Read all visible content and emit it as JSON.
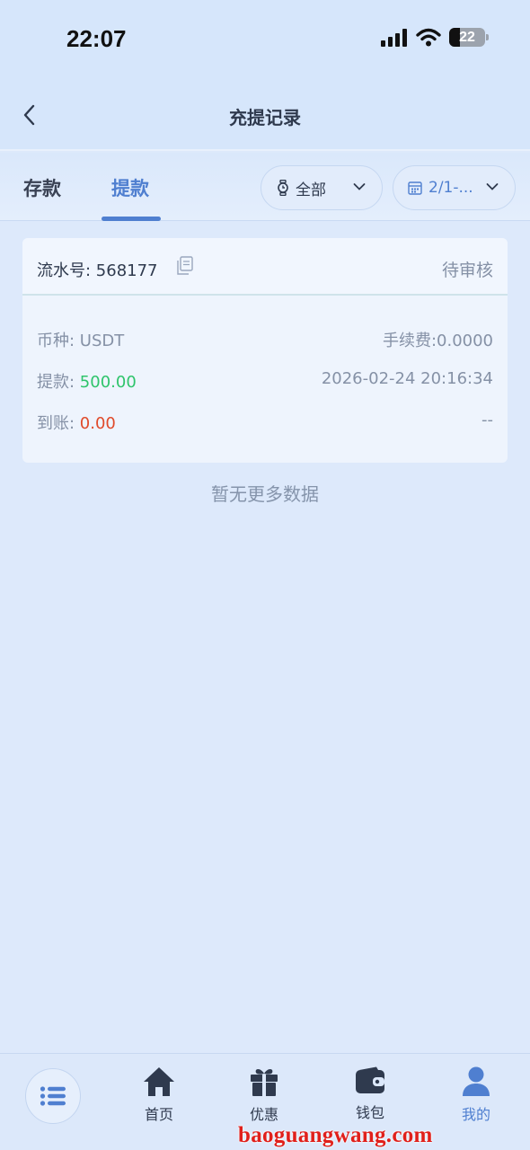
{
  "status_bar": {
    "time": "22:07",
    "battery": "22"
  },
  "header": {
    "title": "充提记录"
  },
  "tabs": [
    {
      "label": "存款"
    },
    {
      "label": "提款"
    }
  ],
  "filters": {
    "status_label": "全部",
    "date_label": "2/1-..."
  },
  "record": {
    "serial_label": "流水号: 568177",
    "status": "待审核",
    "currency_label": "币种: USDT",
    "fee": "手续费:0.0000",
    "withdraw_label": "提款: ",
    "withdraw_amount": "500.00",
    "time": "2026-02-24 20:16:34",
    "received_label": "到账: ",
    "received_amount": "0.00",
    "received_right": "--"
  },
  "list": {
    "no_more": "暂无更多数据"
  },
  "bottom_nav": [
    {
      "label": "首页",
      "icon": "home-icon"
    },
    {
      "label": "优惠",
      "icon": "gift-icon"
    },
    {
      "label": "钱包",
      "icon": "wallet-icon"
    },
    {
      "label": "我的",
      "icon": "user-icon"
    }
  ],
  "watermark": "baoguangwang.com",
  "colors": {
    "accent": "#4f7fd0",
    "positive": "#2ec46b",
    "negative": "#e04a2a",
    "background": "#dde9fb"
  }
}
